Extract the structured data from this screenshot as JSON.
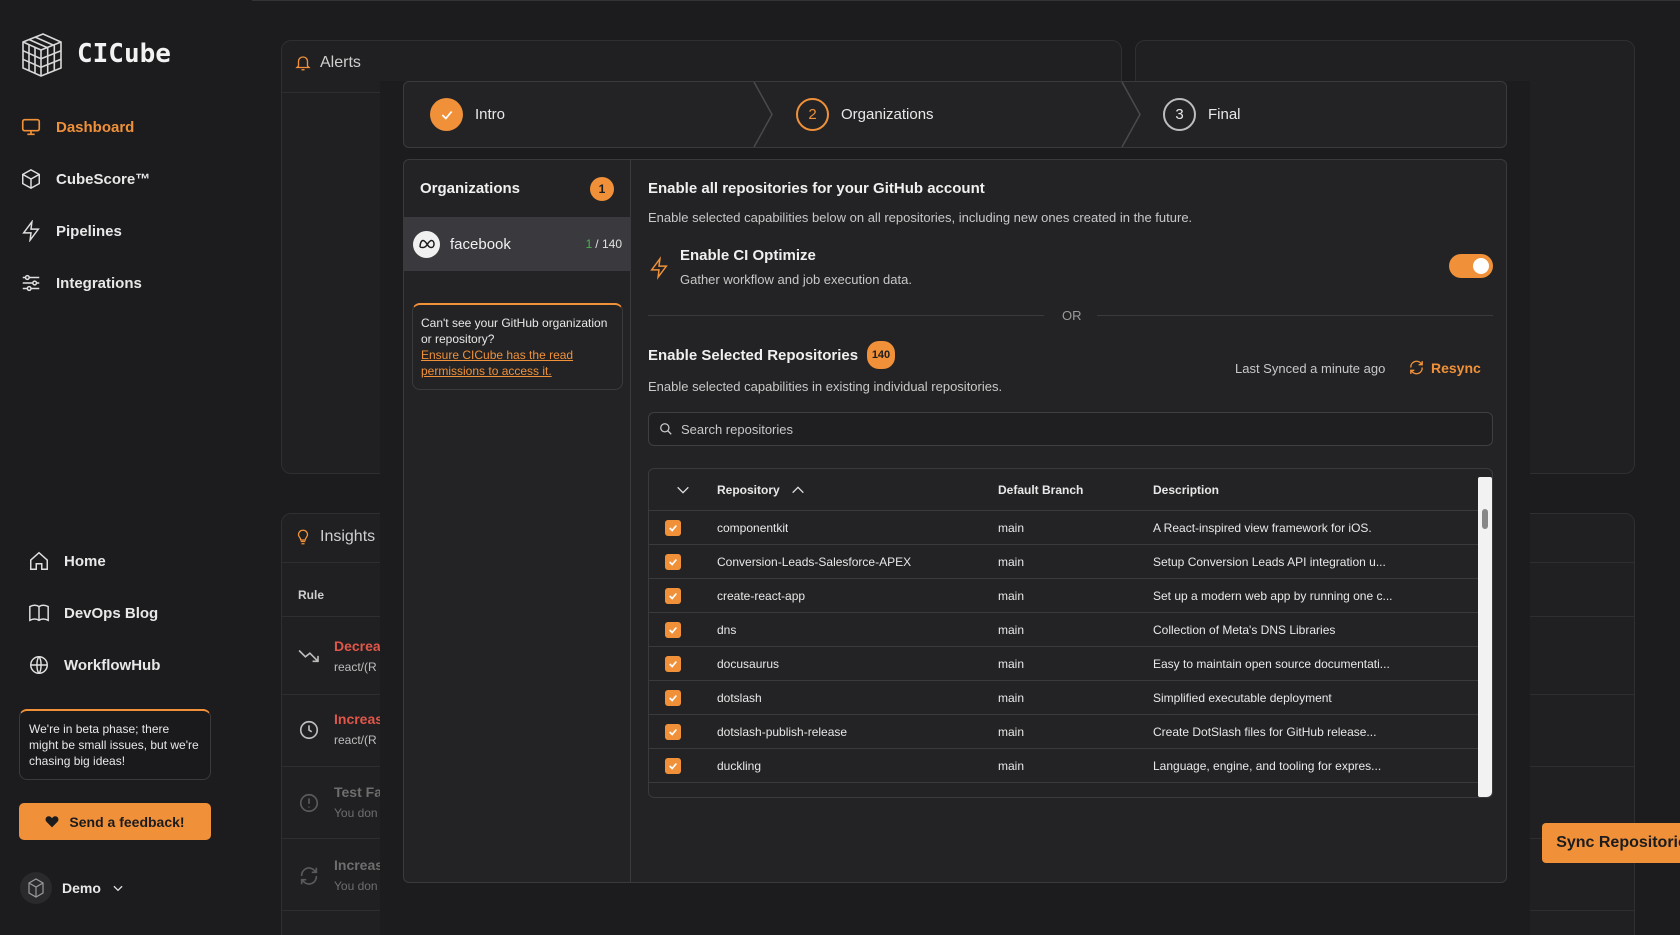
{
  "app": {
    "name": "CICube"
  },
  "sidebar": {
    "nav": [
      {
        "label": "Dashboard",
        "icon": "monitor-icon",
        "active": true
      },
      {
        "label": "CubeScore™",
        "icon": "cube-icon"
      },
      {
        "label": "Pipelines",
        "icon": "lightning-icon"
      },
      {
        "label": "Integrations",
        "icon": "sliders-icon"
      }
    ],
    "bottom_nav": [
      {
        "label": "Home",
        "icon": "home-icon"
      },
      {
        "label": "DevOps Blog",
        "icon": "book-icon"
      },
      {
        "label": "WorkflowHub",
        "icon": "globe-icon"
      }
    ],
    "beta_notice": "We're in beta phase; there might be small issues, but we're chasing big ideas!",
    "feedback_label": "Send a feedback!",
    "user": "Demo"
  },
  "background": {
    "alerts_title": "Alerts",
    "insights_title": "Insights",
    "rule_header": "Rule",
    "insights": [
      {
        "title": "Decrea",
        "sub": "react/(R",
        "color": "#e0574a"
      },
      {
        "title": "Increas",
        "sub": "react/(R",
        "color": "#e0574a"
      },
      {
        "title": "Test Fa",
        "sub": "You don",
        "color": "#6e6e6e"
      },
      {
        "title": "Increas",
        "sub": "You don",
        "color": "#6e6e6e"
      }
    ]
  },
  "stepper": {
    "steps": [
      {
        "label": "Intro",
        "state": "done"
      },
      {
        "number": "2",
        "label": "Organizations",
        "state": "active"
      },
      {
        "number": "3",
        "label": "Final",
        "state": "pending"
      }
    ]
  },
  "organizations": {
    "title": "Organizations",
    "count": "1",
    "items": [
      {
        "name": "facebook",
        "selected": "1",
        "total": "/ 140"
      }
    ],
    "help_text": "Can't see your GitHub organization or repository?",
    "help_link": "Ensure CICube has the read permissions to access it."
  },
  "enable_all": {
    "title": "Enable all repositories for your GitHub account",
    "description": "Enable selected capabilities below on all repositories, including new ones created in the future.",
    "ci_optimize_title": "Enable CI Optimize",
    "ci_optimize_desc": "Gather workflow and job execution data.",
    "ci_optimize_enabled": true
  },
  "or_label": "OR",
  "selected_repos": {
    "title": "Enable Selected Repositories",
    "count": "140",
    "description": "Enable selected capabilities in existing individual repositories.",
    "last_synced": "Last Synced a minute ago",
    "resync_label": "Resync",
    "search_placeholder": "Search repositories"
  },
  "table": {
    "headers": {
      "repository": "Repository",
      "branch": "Default Branch",
      "description": "Description"
    },
    "rows": [
      {
        "name": "componentkit",
        "branch": "main",
        "description": "A React-inspired view framework for iOS."
      },
      {
        "name": "Conversion-Leads-Salesforce-APEX",
        "branch": "main",
        "description": "Setup Conversion Leads API integration u..."
      },
      {
        "name": "create-react-app",
        "branch": "main",
        "description": "Set up a modern web app by running one c..."
      },
      {
        "name": "dns",
        "branch": "main",
        "description": "Collection of Meta's DNS Libraries"
      },
      {
        "name": "docusaurus",
        "branch": "main",
        "description": "Easy to maintain open source documentati..."
      },
      {
        "name": "dotslash",
        "branch": "main",
        "description": "Simplified executable deployment"
      },
      {
        "name": "dotslash-publish-release",
        "branch": "main",
        "description": "Create DotSlash files for GitHub release..."
      },
      {
        "name": "duckling",
        "branch": "main",
        "description": "Language, engine, and tooling for expres..."
      }
    ]
  },
  "sync_button": "Sync Repositories",
  "colors": {
    "accent": "#f0913a",
    "background": "#1c1c1e",
    "panel": "#232325"
  }
}
